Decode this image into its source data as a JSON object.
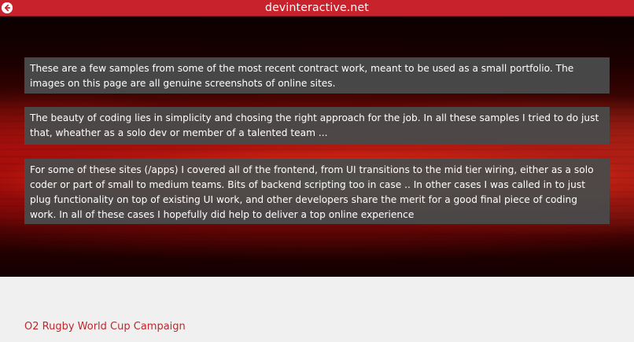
{
  "header": {
    "title": "devinteractive.net",
    "back_icon": "arrow-left-circle-icon",
    "bar_color": "#c8232c"
  },
  "intro": {
    "paragraphs": [
      "These are a few samples from some of the most recent contract work, meant to be used as a small portfolio. The images on this page are all genuine screenshots of online sites.",
      "The beauty of coding lies in simplicity and chosing the right approach for the job. In all these samples I tried to do just that, wheather as a solo dev or member of a talented team ...",
      "For some of these sites (/apps) I covered all of the frontend, from UI transitions to the mid tier wiring, either as a solo coder or part of small to medium teams. Bits of backend scripting too in case .. In other cases I was called in to just plug functionality on top of existing UI work, and other developers share the merit for a good final piece of coding work. In all of these cases I hopefully did help to deliver a top online experience"
    ]
  },
  "portfolio": {
    "first_item_label": "O2 Rugby World Cup Campaign",
    "link_color": "#c0272d"
  }
}
